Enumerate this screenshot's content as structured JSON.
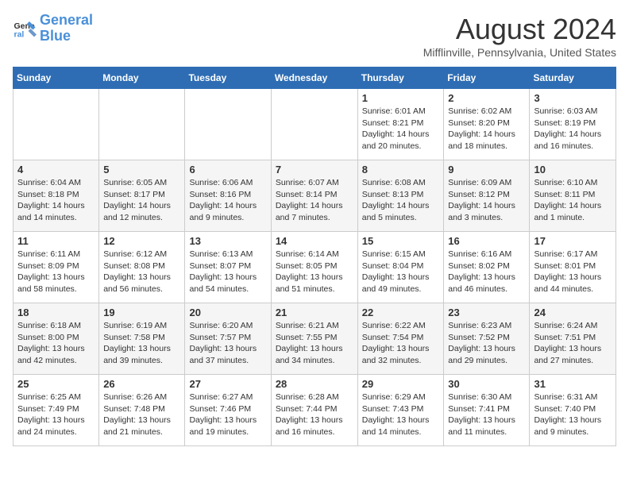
{
  "logo": {
    "line1": "General",
    "line2": "Blue"
  },
  "title": "August 2024",
  "location": "Mifflinville, Pennsylvania, United States",
  "days_of_week": [
    "Sunday",
    "Monday",
    "Tuesday",
    "Wednesday",
    "Thursday",
    "Friday",
    "Saturday"
  ],
  "weeks": [
    [
      {
        "day": "",
        "info": ""
      },
      {
        "day": "",
        "info": ""
      },
      {
        "day": "",
        "info": ""
      },
      {
        "day": "",
        "info": ""
      },
      {
        "day": "1",
        "info": "Sunrise: 6:01 AM\nSunset: 8:21 PM\nDaylight: 14 hours\nand 20 minutes."
      },
      {
        "day": "2",
        "info": "Sunrise: 6:02 AM\nSunset: 8:20 PM\nDaylight: 14 hours\nand 18 minutes."
      },
      {
        "day": "3",
        "info": "Sunrise: 6:03 AM\nSunset: 8:19 PM\nDaylight: 14 hours\nand 16 minutes."
      }
    ],
    [
      {
        "day": "4",
        "info": "Sunrise: 6:04 AM\nSunset: 8:18 PM\nDaylight: 14 hours\nand 14 minutes."
      },
      {
        "day": "5",
        "info": "Sunrise: 6:05 AM\nSunset: 8:17 PM\nDaylight: 14 hours\nand 12 minutes."
      },
      {
        "day": "6",
        "info": "Sunrise: 6:06 AM\nSunset: 8:16 PM\nDaylight: 14 hours\nand 9 minutes."
      },
      {
        "day": "7",
        "info": "Sunrise: 6:07 AM\nSunset: 8:14 PM\nDaylight: 14 hours\nand 7 minutes."
      },
      {
        "day": "8",
        "info": "Sunrise: 6:08 AM\nSunset: 8:13 PM\nDaylight: 14 hours\nand 5 minutes."
      },
      {
        "day": "9",
        "info": "Sunrise: 6:09 AM\nSunset: 8:12 PM\nDaylight: 14 hours\nand 3 minutes."
      },
      {
        "day": "10",
        "info": "Sunrise: 6:10 AM\nSunset: 8:11 PM\nDaylight: 14 hours\nand 1 minute."
      }
    ],
    [
      {
        "day": "11",
        "info": "Sunrise: 6:11 AM\nSunset: 8:09 PM\nDaylight: 13 hours\nand 58 minutes."
      },
      {
        "day": "12",
        "info": "Sunrise: 6:12 AM\nSunset: 8:08 PM\nDaylight: 13 hours\nand 56 minutes."
      },
      {
        "day": "13",
        "info": "Sunrise: 6:13 AM\nSunset: 8:07 PM\nDaylight: 13 hours\nand 54 minutes."
      },
      {
        "day": "14",
        "info": "Sunrise: 6:14 AM\nSunset: 8:05 PM\nDaylight: 13 hours\nand 51 minutes."
      },
      {
        "day": "15",
        "info": "Sunrise: 6:15 AM\nSunset: 8:04 PM\nDaylight: 13 hours\nand 49 minutes."
      },
      {
        "day": "16",
        "info": "Sunrise: 6:16 AM\nSunset: 8:02 PM\nDaylight: 13 hours\nand 46 minutes."
      },
      {
        "day": "17",
        "info": "Sunrise: 6:17 AM\nSunset: 8:01 PM\nDaylight: 13 hours\nand 44 minutes."
      }
    ],
    [
      {
        "day": "18",
        "info": "Sunrise: 6:18 AM\nSunset: 8:00 PM\nDaylight: 13 hours\nand 42 minutes."
      },
      {
        "day": "19",
        "info": "Sunrise: 6:19 AM\nSunset: 7:58 PM\nDaylight: 13 hours\nand 39 minutes."
      },
      {
        "day": "20",
        "info": "Sunrise: 6:20 AM\nSunset: 7:57 PM\nDaylight: 13 hours\nand 37 minutes."
      },
      {
        "day": "21",
        "info": "Sunrise: 6:21 AM\nSunset: 7:55 PM\nDaylight: 13 hours\nand 34 minutes."
      },
      {
        "day": "22",
        "info": "Sunrise: 6:22 AM\nSunset: 7:54 PM\nDaylight: 13 hours\nand 32 minutes."
      },
      {
        "day": "23",
        "info": "Sunrise: 6:23 AM\nSunset: 7:52 PM\nDaylight: 13 hours\nand 29 minutes."
      },
      {
        "day": "24",
        "info": "Sunrise: 6:24 AM\nSunset: 7:51 PM\nDaylight: 13 hours\nand 27 minutes."
      }
    ],
    [
      {
        "day": "25",
        "info": "Sunrise: 6:25 AM\nSunset: 7:49 PM\nDaylight: 13 hours\nand 24 minutes."
      },
      {
        "day": "26",
        "info": "Sunrise: 6:26 AM\nSunset: 7:48 PM\nDaylight: 13 hours\nand 21 minutes."
      },
      {
        "day": "27",
        "info": "Sunrise: 6:27 AM\nSunset: 7:46 PM\nDaylight: 13 hours\nand 19 minutes."
      },
      {
        "day": "28",
        "info": "Sunrise: 6:28 AM\nSunset: 7:44 PM\nDaylight: 13 hours\nand 16 minutes."
      },
      {
        "day": "29",
        "info": "Sunrise: 6:29 AM\nSunset: 7:43 PM\nDaylight: 13 hours\nand 14 minutes."
      },
      {
        "day": "30",
        "info": "Sunrise: 6:30 AM\nSunset: 7:41 PM\nDaylight: 13 hours\nand 11 minutes."
      },
      {
        "day": "31",
        "info": "Sunrise: 6:31 AM\nSunset: 7:40 PM\nDaylight: 13 hours\nand 9 minutes."
      }
    ]
  ]
}
